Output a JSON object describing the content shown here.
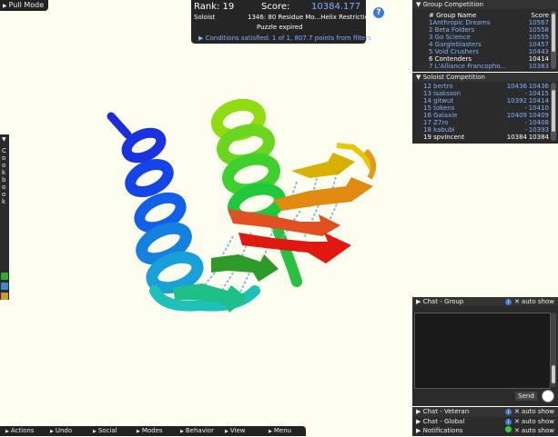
{
  "pull_mode": "Pull Mode",
  "score_panel": {
    "rank": "Rank: 19",
    "score_label": "Score:",
    "score_value": "10384.177",
    "mode": "Soloist",
    "puzzle": "1346: 80 Residue Mo...Helix Restrictions",
    "status": "Puzzle expired",
    "conditions": "Conditions satisfied: 1 of 1, 807.7 points from filters"
  },
  "group_competition": {
    "title": "Group Competition",
    "columns": [
      "# Group Name",
      "Score"
    ],
    "rows": [
      {
        "name": "1Anthropic Dreams",
        "score": "10567"
      },
      {
        "name": "2 Beta Folders",
        "score": "10558"
      },
      {
        "name": "3 Go Science",
        "score": "10555"
      },
      {
        "name": "4 Gargleblasters",
        "score": "10457"
      },
      {
        "name": "5 Void Crushers",
        "score": "10443"
      },
      {
        "name": "6 Contenders",
        "score": "10414"
      },
      {
        "name": "7 L'Alliance Francopho...",
        "score": "10383"
      }
    ]
  },
  "soloist_competition": {
    "title": "Soloist Competition",
    "rows": [
      {
        "name": "12 bertro",
        "mid": "10436",
        "score": "10436"
      },
      {
        "name": "13 isaksson",
        "mid": "-",
        "score": "10415"
      },
      {
        "name": "14 gitwut",
        "mid": "10392",
        "score": "10414"
      },
      {
        "name": "15 tokens",
        "mid": "-",
        "score": "10410"
      },
      {
        "name": "16 Galaxie",
        "mid": "10409",
        "score": "10409"
      },
      {
        "name": "17 Z7ro",
        "mid": "-",
        "score": "10408"
      },
      {
        "name": "18 kabubi",
        "mid": "-",
        "score": "10393"
      },
      {
        "name": "19 spvincent",
        "mid": "10384",
        "score": "10384"
      }
    ]
  },
  "cookbook": "Cookbook",
  "chat_group": {
    "title": "Chat - Group",
    "auto_show": "auto show",
    "send": "Send"
  },
  "chat_veteran": {
    "title": "Chat - Veteran",
    "auto_show": "auto show"
  },
  "chat_global": {
    "title": "Chat - Global",
    "auto_show": "auto show"
  },
  "notifications": {
    "title": "Notifications",
    "auto_show": "auto show"
  },
  "toolbar": {
    "actions": "Actions",
    "undo": "Undo",
    "social": "Social",
    "modes": "Modes",
    "behavior": "Behavior",
    "view": "View",
    "menu": "Menu"
  },
  "colors": {
    "background": "#fdfdf0",
    "accent": "#7fb2ff"
  }
}
